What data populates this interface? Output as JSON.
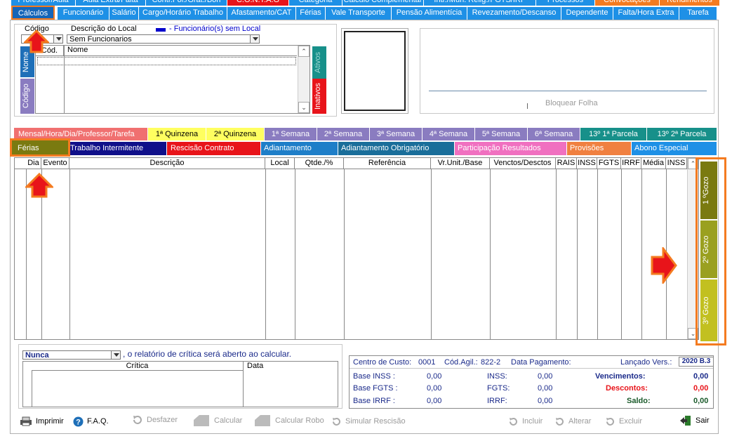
{
  "top_tabs_row1": [
    "Professor/Aula",
    "Aula Extra/Falta",
    "Contr.Fol./Grat./Bon",
    "C.O.N.T.A.G",
    "Categoria",
    "Cálculo Complementar",
    "Intr./Mun. Relig./FGTS/IRF",
    "Processos",
    "Convocações",
    "Rendimentos"
  ],
  "top_tabs_row2": [
    "Cálculos",
    "Funcionário",
    "Salário",
    "Cargo/Horário Trabalho",
    "Afastamento/CAT",
    "Férias",
    "Vale Transporte",
    "Pensão Alimentícia",
    "Revezamento/Descanso",
    "Dependente",
    "Falta/Hora Extra",
    "Tarefa"
  ],
  "filter": {
    "codigo_label": "Código",
    "descricao_label": "Descrição do Local",
    "legend_text": "- Funcionário(s) sem Local",
    "descricao_value": "Sem Funcionarios",
    "col_cod": "Cód.",
    "col_nome": "Nome",
    "side_tab_nome": "Nome",
    "side_tab_codigo": "Código",
    "tab_ativos": "Ativos",
    "tab_inativos": "Inativos"
  },
  "bloquear_folha": "Bloquear Folha",
  "mid_tabs_row1": [
    "Mensal/Hora/Dia/Professor/Tarefa",
    "1ª Quinzena",
    "2ª Quinzena",
    "1ª Semana",
    "2ª Semana",
    "3ª Semana",
    "4ª Semana",
    "5ª Semana",
    "6ª Semana",
    "13º  1ª Parcela",
    "13º  2ª  Parcela"
  ],
  "mid_tabs_row2": [
    "Férias",
    "Trabalho Intermitente",
    "Rescisão Contrato",
    "Adiantamento",
    "Adiantamento Obrigatório",
    "Participação Resultados",
    "Provisões",
    "Abono Especial"
  ],
  "grid_headers": [
    "Dia",
    "Evento",
    "Descrição",
    "Local",
    "Qtde./%",
    "Referência",
    "Vr.Unit./Base",
    "Venctos/Desctos",
    "RAIS",
    "INSS",
    "FGTS",
    "IRRF",
    "Média",
    "INSS"
  ],
  "gozo_tabs": [
    "1 ºGozo",
    "2º Gozo",
    "3º Gozo"
  ],
  "critica": {
    "select_value": "Nunca",
    "text": ", o relatório de crítica será aberto ao calcular.",
    "col_critica": "Crítica",
    "col_data": "Data"
  },
  "summary": {
    "centro_custo_label": "Centro de Custo:",
    "centro_custo_value": "0001",
    "cod_agil_label": "Cód.Agil.:",
    "cod_agil_value": "822-2",
    "data_pagamento_label": "Data Pagamento:",
    "lancado_label": "Lançado Vers.:",
    "lancado_value": "2020 B.3",
    "base_inss_label": "Base  INSS :",
    "base_inss_value": "0,00",
    "base_fgts_label": "Base FGTS :",
    "base_fgts_value": "0,00",
    "base_irrf_label": "Base  IRRF :",
    "base_irrf_value": "0,00",
    "inss_label": "INSS:",
    "inss_value": "0,00",
    "fgts_label": "FGTS:",
    "fgts_value": "0,00",
    "irrf_label": "IRRF:",
    "irrf_value": "0,00",
    "vencimentos_label": "Vencimentos:",
    "vencimentos_value": "0,00",
    "descontos_label": "Descontos:",
    "descontos_value": "0,00",
    "saldo_label": "Saldo:",
    "saldo_value": "0,00"
  },
  "toolbar": {
    "imprimir": "Imprimir",
    "faq": "F.A.Q.",
    "desfazer": "Desfazer",
    "calcular": "Calcular",
    "calcular_robo": "Calcular Robo",
    "simular": "Simular Rescisão",
    "incluir": "Incluir",
    "alterar": "Alterar",
    "excluir": "Excluir",
    "sair": "Sair"
  },
  "colors": {
    "tab_blue": "#1e90e6",
    "highlight_orange": "#f47b20",
    "arrow_red": "#e8141a",
    "gozo_olive": "#8a8a10"
  }
}
